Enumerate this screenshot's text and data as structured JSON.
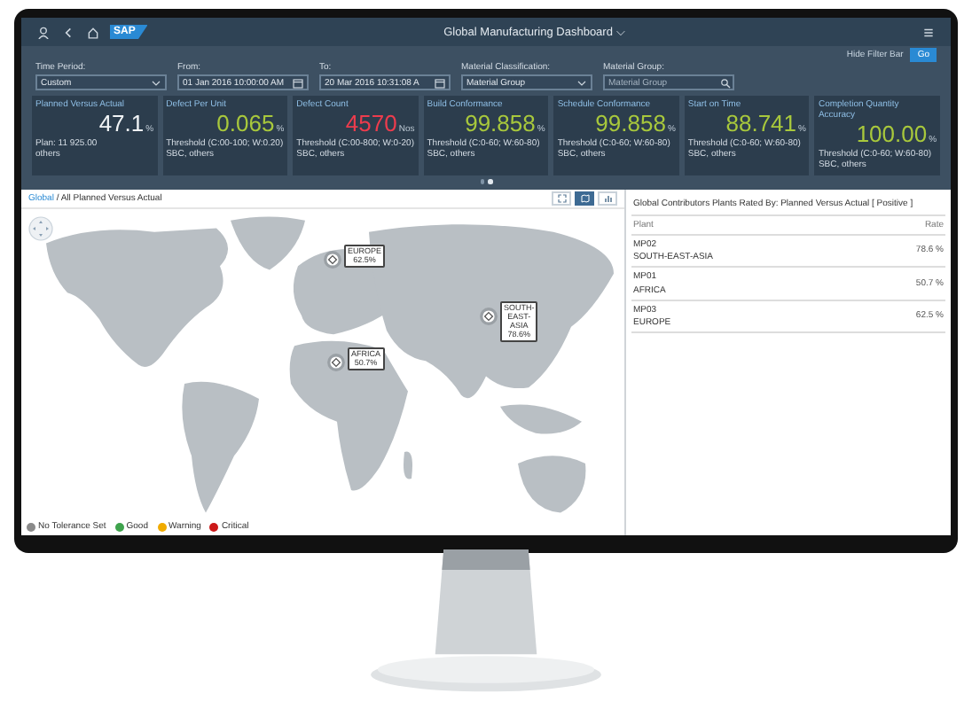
{
  "shell_bar": {
    "title": "Global Manufacturing Dashboard ⌵",
    "logo": "SAP"
  },
  "filter_bar": {
    "hide_button": "Hide Filter Bar",
    "go_button": "Go",
    "filters": [
      {
        "label": "Time Period:",
        "value": "Custom",
        "kind": "select"
      },
      {
        "label": "From:",
        "value": "01 Jan 2016 10:00:00 AM",
        "kind": "date"
      },
      {
        "label": "To:",
        "value": "20 Mar 2016 10:31:08 A",
        "kind": "date"
      },
      {
        "label": "Material Classification:",
        "value": "Material Group",
        "kind": "select"
      },
      {
        "label": "Material Group:",
        "placeholder": "Material Group",
        "kind": "search"
      }
    ]
  },
  "kpi_tiles": [
    {
      "title": "Planned Versus Actual",
      "value": "47.1",
      "unit": "%",
      "color": "#f1f4f6",
      "footer": [
        "Plan: 11 925.00",
        "others"
      ]
    },
    {
      "title": "Defect Per Unit",
      "value": "0.065",
      "unit": "%",
      "color": "#a8c83c",
      "footer": [
        "Threshold (C:00-100; W:0.20)",
        "SBC, others"
      ]
    },
    {
      "title": "Defect Count",
      "value": "4570",
      "unit": "Nos",
      "color": "#ee3c4d",
      "footer": [
        "Threshold (C:00-800; W:0-20)",
        "SBC, others"
      ]
    },
    {
      "title": "Build Conformance",
      "value": "99.858",
      "unit": "%",
      "color": "#a8c83c",
      "footer": [
        "Threshold (C:0-60; W:60-80)",
        "SBC, others"
      ]
    },
    {
      "title": "Schedule Conformance",
      "value": "99.858",
      "unit": "%",
      "color": "#a8c83c",
      "footer": [
        "Threshold (C:0-60; W:60-80)",
        "SBC, others"
      ]
    },
    {
      "title": "Start on Time",
      "value": "88.741",
      "unit": "%",
      "color": "#a8c83c",
      "footer": [
        "Threshold (C:0-60; W:60-80)",
        "SBC, others"
      ]
    },
    {
      "title": "Completion Quantity Accuracy",
      "value": "100.00",
      "unit": "%",
      "color": "#a8c83c",
      "footer": [
        "Threshold (C:0-60; W:60-80)",
        "SBC, others"
      ]
    }
  ],
  "pager": [
    {
      "selected": false
    },
    {
      "selected": true
    }
  ],
  "map_panel": {
    "breadcrumb_link": "Global",
    "breadcrumb_rest": " / All Planned Versus Actual",
    "view_buttons": [
      {
        "kind": "fullscreen",
        "selected": false
      },
      {
        "kind": "map",
        "selected": true
      },
      {
        "kind": "chart",
        "selected": false
      }
    ],
    "markers": [
      {
        "lines": [
          "EUROPE",
          "62.5%"
        ]
      },
      {
        "lines": [
          "AFRICA",
          "50.7%"
        ]
      },
      {
        "lines": [
          "SOUTH-",
          "EAST-",
          "ASIA",
          "78.6%"
        ]
      }
    ],
    "legend": [
      {
        "label": "No Tolerance Set",
        "color": "#8a8a8a"
      },
      {
        "label": "Good",
        "color": "#3fa34d"
      },
      {
        "label": "Warning",
        "color": "#f0ab00"
      },
      {
        "label": "Critical",
        "color": "#cc1919"
      }
    ]
  },
  "contributors": {
    "title": "Global Contributors Plants Rated By: Planned Versus Actual [ Positive ]",
    "columns": [
      "Plant",
      "Rate"
    ],
    "rows": [
      {
        "plant": "MP02",
        "region": "SOUTH-EAST-ASIA",
        "rate": "78.6 %"
      },
      {
        "plant": "MP01",
        "region": "AFRICA",
        "rate": "50.7 %"
      },
      {
        "plant": "MP03",
        "region": "EUROPE",
        "rate": "62.5 %"
      }
    ]
  }
}
